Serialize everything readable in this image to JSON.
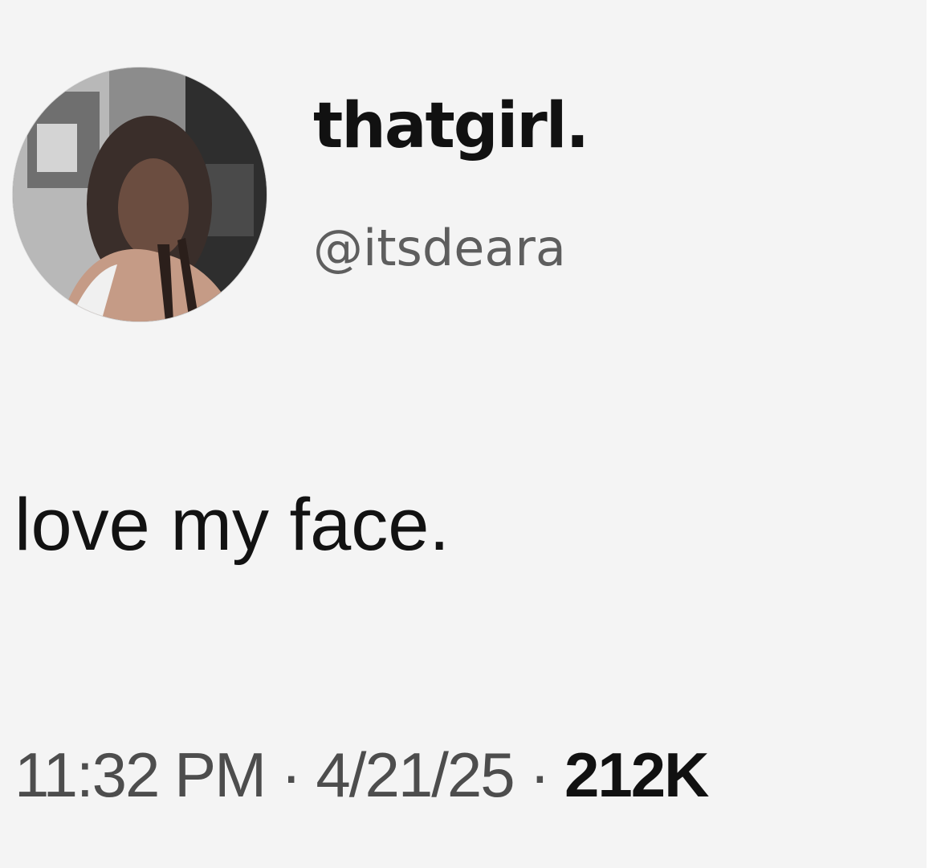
{
  "tweet": {
    "display_name": "thatgirl.",
    "handle": "@itsdeara",
    "text": "love my face.",
    "time": "11:32 PM",
    "separator": "·",
    "date": "4/21/25",
    "views": "212K"
  },
  "avatar": {
    "icon": "profile-photo"
  },
  "colors": {
    "background": "#f4f4f4",
    "text_primary": "#111111",
    "text_secondary": "#5e5e5e"
  }
}
